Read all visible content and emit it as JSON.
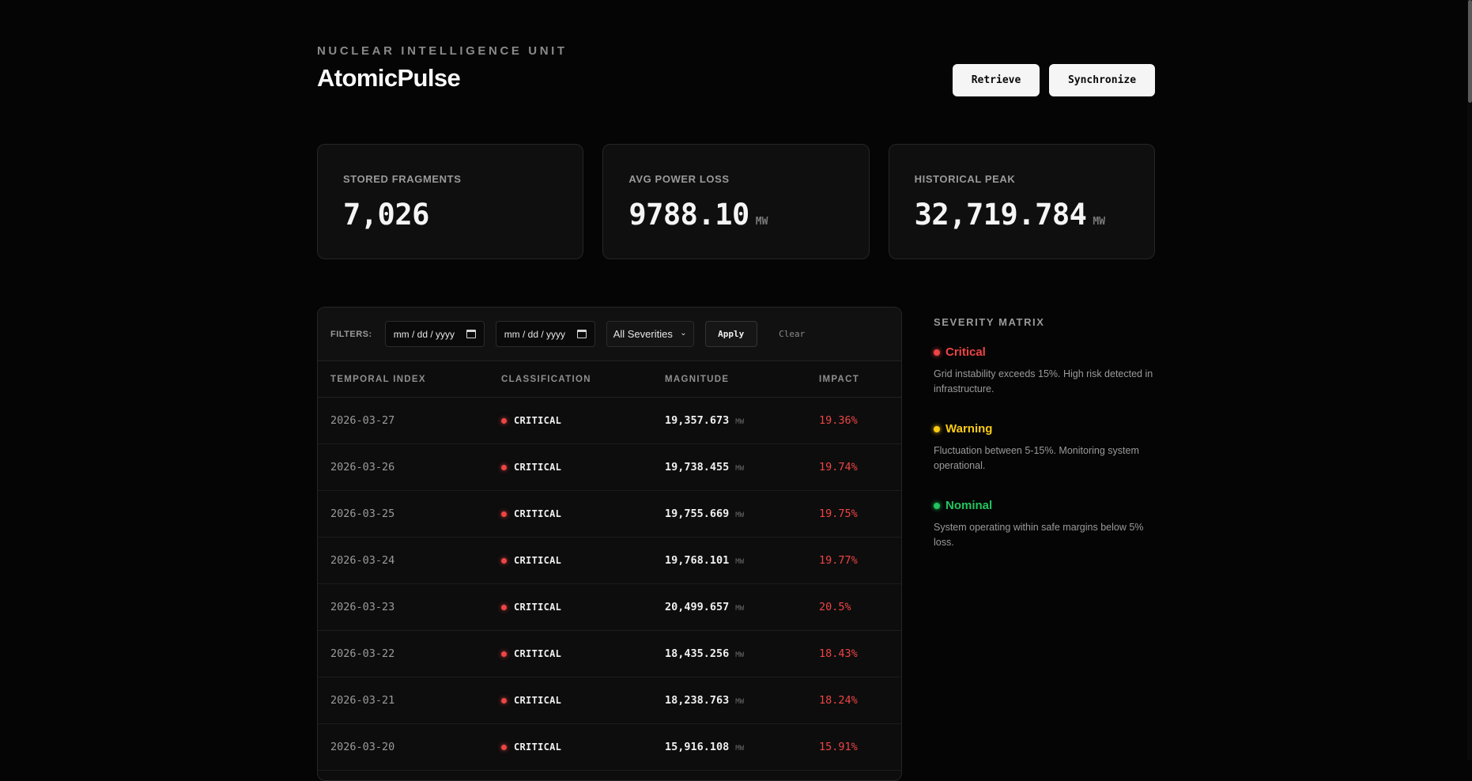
{
  "header": {
    "eyebrow": "NUCLEAR INTELLIGENCE UNIT",
    "title": "AtomicPulse",
    "retrieve_label": "Retrieve",
    "sync_label": "Synchronize"
  },
  "stats": [
    {
      "label": "STORED FRAGMENTS",
      "value": "7,026",
      "unit": ""
    },
    {
      "label": "AVG POWER LOSS",
      "value": "9788.10",
      "unit": "MW"
    },
    {
      "label": "HISTORICAL PEAK",
      "value": "32,719.784",
      "unit": "MW"
    }
  ],
  "filters": {
    "label": "FILTERS:",
    "date_from_placeholder": "mm / dd / yyyy",
    "date_to_placeholder": "mm / dd / yyyy",
    "severity_selected": "All Severities",
    "apply_label": "Apply",
    "clear_label": "Clear"
  },
  "table": {
    "columns": [
      "TEMPORAL INDEX",
      "CLASSIFICATION",
      "MAGNITUDE",
      "IMPACT"
    ],
    "rows": [
      {
        "date": "2026-03-27",
        "class": "CRITICAL",
        "magnitude": "19,357.673",
        "unit": "MW",
        "impact": "19.36%"
      },
      {
        "date": "2026-03-26",
        "class": "CRITICAL",
        "magnitude": "19,738.455",
        "unit": "MW",
        "impact": "19.74%"
      },
      {
        "date": "2026-03-25",
        "class": "CRITICAL",
        "magnitude": "19,755.669",
        "unit": "MW",
        "impact": "19.75%"
      },
      {
        "date": "2026-03-24",
        "class": "CRITICAL",
        "magnitude": "19,768.101",
        "unit": "MW",
        "impact": "19.77%"
      },
      {
        "date": "2026-03-23",
        "class": "CRITICAL",
        "magnitude": "20,499.657",
        "unit": "MW",
        "impact": "20.5%"
      },
      {
        "date": "2026-03-22",
        "class": "CRITICAL",
        "magnitude": "18,435.256",
        "unit": "MW",
        "impact": "18.43%"
      },
      {
        "date": "2026-03-21",
        "class": "CRITICAL",
        "magnitude": "18,238.763",
        "unit": "MW",
        "impact": "18.24%"
      },
      {
        "date": "2026-03-20",
        "class": "CRITICAL",
        "magnitude": "15,916.108",
        "unit": "MW",
        "impact": "15.91%"
      }
    ]
  },
  "matrix": {
    "title": "SEVERITY MATRIX",
    "levels": [
      {
        "name": "Critical",
        "color": "#ef4444",
        "description": "Grid instability exceeds 15%. High risk detected in infrastructure."
      },
      {
        "name": "Warning",
        "color": "#facc15",
        "description": "Fluctuation between 5-15%. Monitoring system operational."
      },
      {
        "name": "Nominal",
        "color": "#22c55e",
        "description": "System operating within safe margins below 5% loss."
      }
    ]
  },
  "colors": {
    "background": "#050505",
    "critical": "#ef4444",
    "warning": "#facc15",
    "nominal": "#22c55e"
  }
}
